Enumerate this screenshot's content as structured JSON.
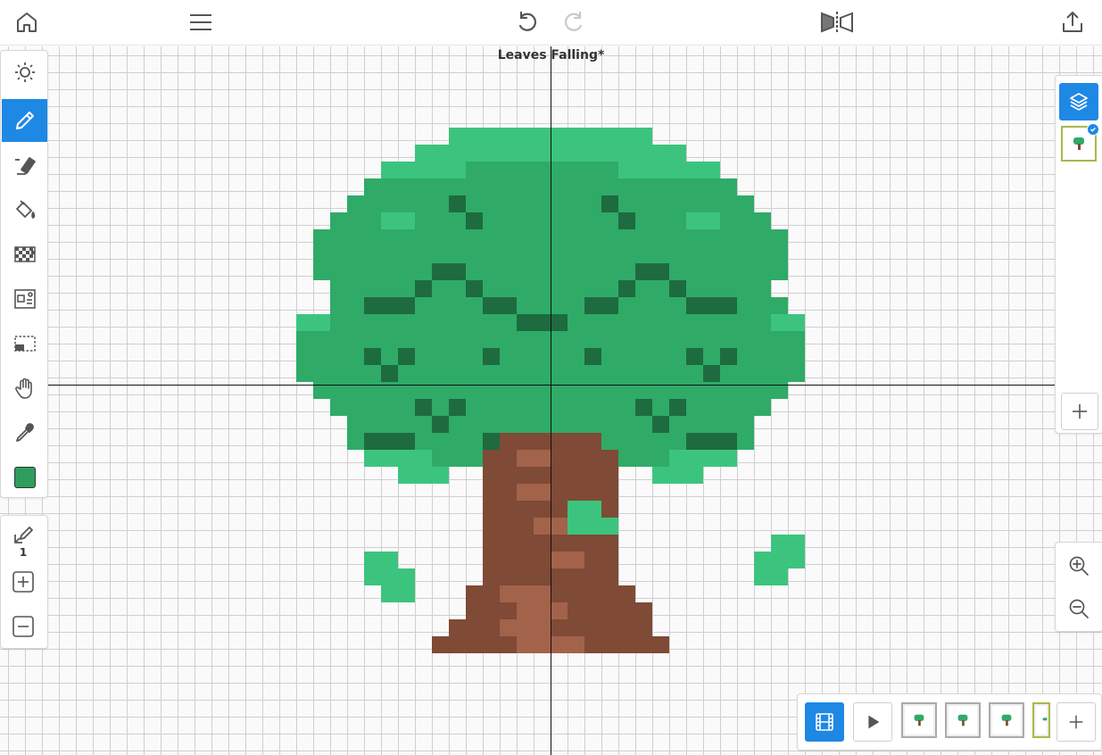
{
  "document": {
    "title": "Leaves Falling*"
  },
  "colors": {
    "accent": "#1e88e5",
    "current_color": "#2e9e5e",
    "leaf_light": "#3cc47e",
    "leaf_mid": "#2fab67",
    "leaf_dark": "#1e6b40",
    "trunk": "#7f4a36",
    "trunk_light": "#a2634a"
  },
  "topbar": {
    "home": "home-icon",
    "menu": "menu-icon",
    "undo": "undo-icon",
    "redo": "redo-icon",
    "mirror": "mirror-icon",
    "share": "share-icon"
  },
  "tools": [
    {
      "id": "brightness",
      "icon": "sun-icon"
    },
    {
      "id": "pencil",
      "icon": "pencil-icon",
      "active": true
    },
    {
      "id": "eraser",
      "icon": "eraser-icon"
    },
    {
      "id": "fill",
      "icon": "paint-bucket-icon"
    },
    {
      "id": "dither",
      "icon": "checker-icon"
    },
    {
      "id": "stamp",
      "icon": "image-stamp-icon"
    },
    {
      "id": "select",
      "icon": "selection-icon"
    },
    {
      "id": "pan",
      "icon": "hand-icon"
    },
    {
      "id": "eyedropper",
      "icon": "eyedropper-icon"
    }
  ],
  "brush": {
    "size": "1"
  },
  "layers": {
    "count": 1
  },
  "frames": {
    "count": 4
  }
}
